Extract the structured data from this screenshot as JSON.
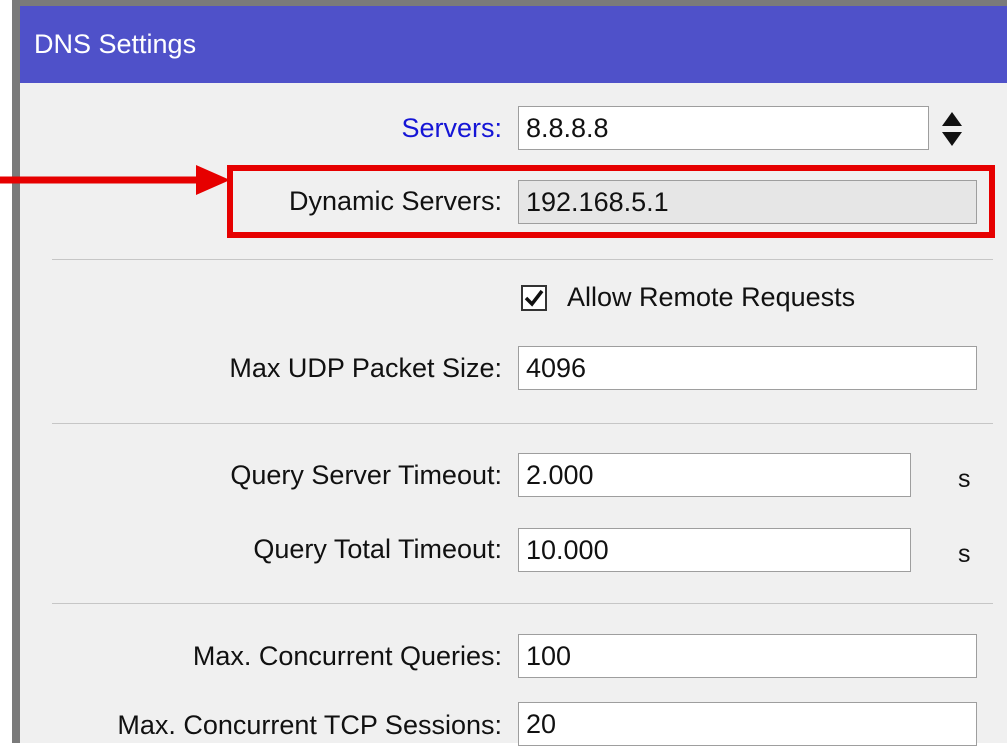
{
  "window": {
    "title": "DNS Settings"
  },
  "fields": {
    "servers": {
      "label": "Servers:",
      "value": "8.8.8.8"
    },
    "dynamic_servers": {
      "label": "Dynamic Servers:",
      "value": "192.168.5.1"
    },
    "allow_remote": {
      "label": "Allow Remote Requests",
      "checked": true
    },
    "max_udp_packet_size": {
      "label": "Max UDP Packet Size:",
      "value": "4096"
    },
    "query_server_timeout": {
      "label": "Query Server Timeout:",
      "value": "2.000",
      "unit": "s"
    },
    "query_total_timeout": {
      "label": "Query Total Timeout:",
      "value": "10.000",
      "unit": "s"
    },
    "max_concurrent_queries": {
      "label": "Max. Concurrent Queries:",
      "value": "100"
    },
    "max_concurrent_tcp_sessions": {
      "label": "Max. Concurrent TCP Sessions:",
      "value": "20"
    }
  },
  "icons": {
    "spin": "up-down-spinner-icon",
    "check": "checkmark-icon",
    "arrow": "red-arrow-icon"
  },
  "colors": {
    "titlebar": "#4f51c9",
    "highlight": "#e60000",
    "link_label": "#1515d6"
  }
}
